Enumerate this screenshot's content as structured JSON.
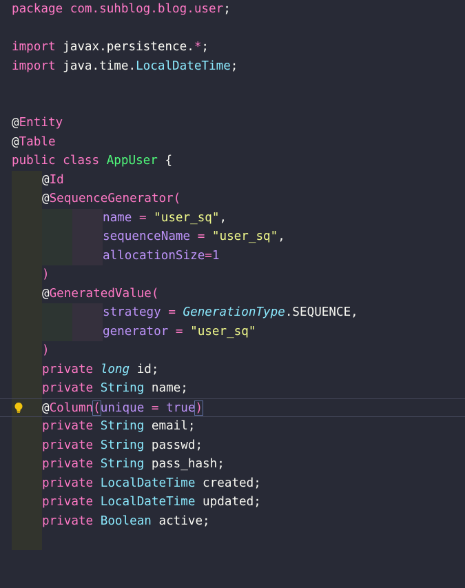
{
  "code": {
    "line1": {
      "kw": "package",
      "pkg": "com.suhblog.blog.user",
      "semi": ";"
    },
    "line3": {
      "kw": "import",
      "pkg": "javax.persistence.",
      "star": "*",
      "semi": ";"
    },
    "line4": {
      "kw": "import",
      "pkg": "java.time.",
      "type": "LocalDateTime",
      "semi": ";"
    },
    "line7": {
      "at": "@",
      "name": "Entity"
    },
    "line8": {
      "at": "@",
      "name": "Table"
    },
    "line9": {
      "kw1": "public",
      "kw2": "class",
      "type": "AppUser",
      "brace": "{"
    },
    "line10": {
      "at": "@",
      "name": "Id"
    },
    "line11": {
      "at": "@",
      "name": "SequenceGenerator",
      "paren": "("
    },
    "line12": {
      "attr": "name",
      "eq": " = ",
      "val": "\"user_sq\"",
      "comma": ","
    },
    "line13": {
      "attr": "sequenceName",
      "eq": " = ",
      "val": "\"user_sq\"",
      "comma": ","
    },
    "line14": {
      "attr": "allocationSize",
      "eq": "=",
      "val": "1"
    },
    "line15": {
      "paren": ")"
    },
    "line16": {
      "at": "@",
      "name": "GeneratedValue",
      "paren": "("
    },
    "line17": {
      "attr": "strategy",
      "eq": " = ",
      "type": "GenerationType",
      "rest": ".SEQUENCE,",
      "comma": ""
    },
    "line18": {
      "attr": "generator",
      "eq": " = ",
      "val": "\"user_sq\""
    },
    "line19": {
      "paren": ")"
    },
    "line20": {
      "kw": "private",
      "type": "long",
      "name": "id;"
    },
    "line21": {
      "kw": "private",
      "type": "String",
      "name": "name;"
    },
    "line22": {
      "at": "@",
      "name": "Column",
      "open": "(",
      "attr": "unique",
      "eq": " = ",
      "val": "true",
      "close": ")"
    },
    "line23": {
      "kw": "private",
      "type": "String",
      "name": "email;"
    },
    "line24": {
      "kw": "private",
      "type": "String",
      "name": "passwd;"
    },
    "line25": {
      "kw": "private",
      "type": "String",
      "name": "pass_hash;"
    },
    "line26": {
      "kw": "private",
      "type": "LocalDateTime",
      "name": "created;"
    },
    "line27": {
      "kw": "private",
      "type": "LocalDateTime",
      "name": "updated;"
    },
    "line28": {
      "kw": "private",
      "type": "Boolean",
      "name": "active;"
    }
  },
  "gutter": {
    "lightbulb_icon": "lightbulb-icon",
    "lightbulb_color": "#f1c40f"
  },
  "colors": {
    "background": "#282a36",
    "keyword": "#ff79c6",
    "type": "#8be9fd",
    "string": "#f1fa8c",
    "number": "#bd93f9",
    "annotation": "#50fa7b"
  }
}
